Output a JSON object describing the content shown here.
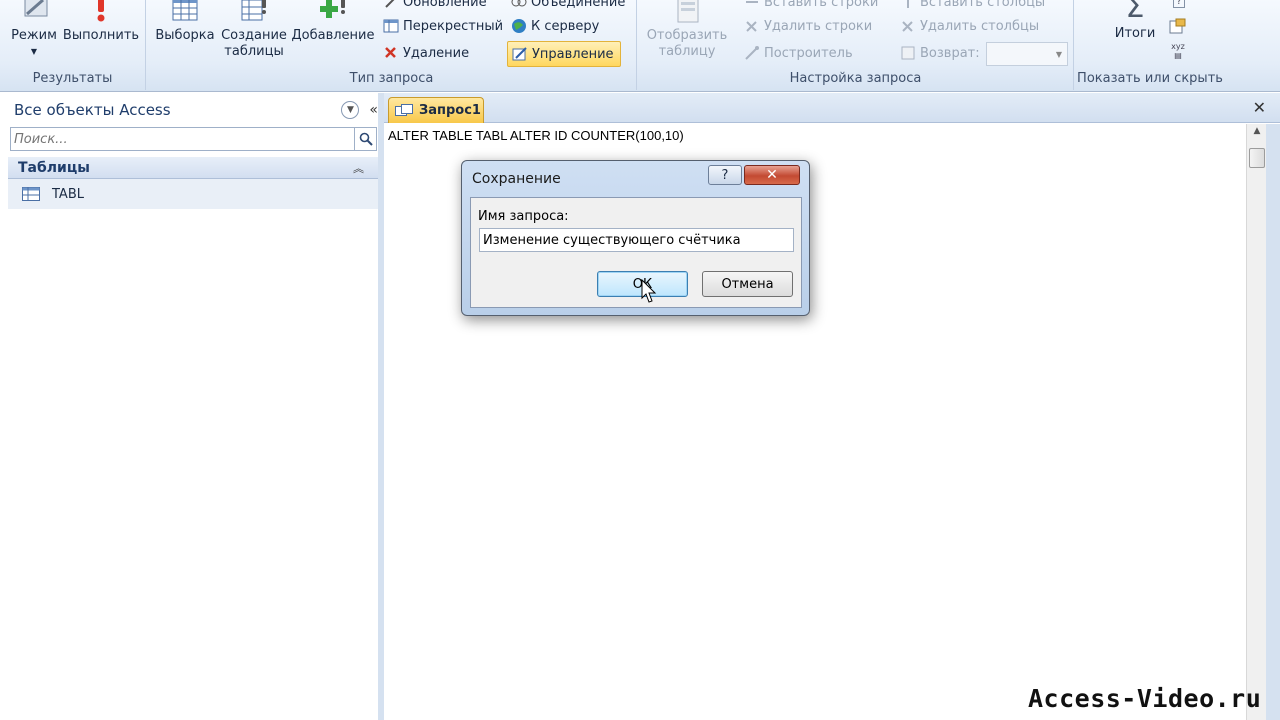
{
  "ribbon": {
    "results": {
      "label": "Результаты",
      "mode": "Режим",
      "run": "Выполнить"
    },
    "query_type": {
      "label": "Тип запроса",
      "select": "Выборка",
      "make_table": "Создание таблицы",
      "append": "Добавление",
      "update": "Обновление",
      "crosstab": "Перекрестный",
      "delete": "Удаление",
      "union": "Объединение",
      "pass_through": "К серверу",
      "data_definition": "Управление"
    },
    "query_setup": {
      "label": "Настройка запроса",
      "show_table": "Отобразить таблицу",
      "insert_rows": "Вставить строки",
      "delete_rows": "Удалить строки",
      "builder": "Построитель",
      "insert_columns": "Вставить столбцы",
      "delete_columns": "Удалить столбцы",
      "return": "Возврат:",
      "return_value": ""
    },
    "show_hide": {
      "label": "Показать или скрыть",
      "totals": "Итоги"
    }
  },
  "nav": {
    "title": "Все объекты Access",
    "search_placeholder": "Поиск...",
    "section": "Таблицы",
    "items": [
      "TABL"
    ]
  },
  "document": {
    "tab_label": "Запрос1",
    "sql": "ALTER TABLE TABL ALTER ID COUNTER(100,10)"
  },
  "dialog": {
    "title": "Сохранение",
    "field_label": "Имя запроса:",
    "field_value": "Изменение существующего счётчика",
    "ok_label": "ОК",
    "cancel_label": "Отмена"
  },
  "watermark": "Access-Video.ru"
}
